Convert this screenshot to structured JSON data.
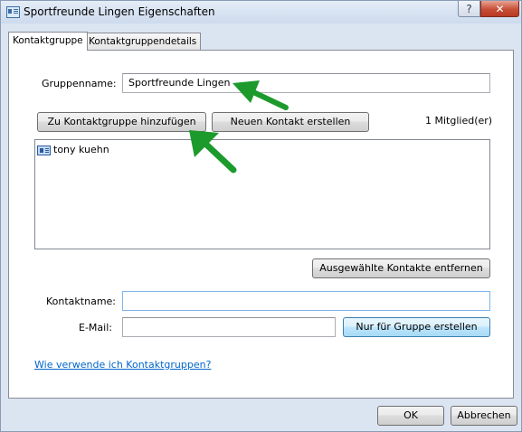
{
  "window": {
    "title": "Sportfreunde Lingen Eigenschaften",
    "help_label": "?",
    "close_label": "✕"
  },
  "tabs": [
    {
      "label": "Kontaktgruppe",
      "active": true
    },
    {
      "label": "Kontaktgruppendetails",
      "active": false
    }
  ],
  "group": {
    "name_label": "Gruppenname:",
    "name_value": "Sportfreunde Lingen"
  },
  "buttons": {
    "add_to_group": "Zu Kontaktgruppe hinzufügen",
    "new_contact": "Neuen Kontakt erstellen",
    "remove_selected": "Ausgewählte Kontakte entfernen",
    "create_for_group": "Nur für Gruppe erstellen",
    "ok": "OK",
    "cancel": "Abbrechen"
  },
  "member_count": "1 Mitglied(er)",
  "members": [
    {
      "name": "tony kuehn",
      "icon": "contact-card-icon"
    }
  ],
  "contact_form": {
    "name_label": "Kontaktname:",
    "name_value": "",
    "email_label": "E-Mail:",
    "email_value": ""
  },
  "help_link": "Wie verwende ich Kontaktgruppen?",
  "annotations": {
    "arrow_color": "#1c9a2c",
    "icon": "green-arrow-icon"
  },
  "colors": {
    "titlebar": "#cddbee",
    "close_button": "#c74e36",
    "link": "#0066cc"
  }
}
